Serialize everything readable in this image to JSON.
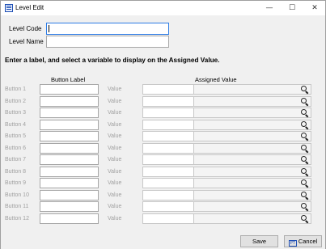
{
  "window": {
    "title": "Level Edit",
    "minimize_glyph": "—",
    "maximize_glyph": "☐",
    "close_glyph": "✕"
  },
  "form": {
    "level_code_label": "Level Code",
    "level_code_value": "",
    "level_name_label": "Level Name",
    "level_name_value": ""
  },
  "instruction": "Enter a label, and select a variable to display on the Assigned Value.",
  "columns": {
    "button_label": "Button Label",
    "assigned_value": "Assigned Value"
  },
  "rows": [
    {
      "label": "Button 1",
      "value_label": "Value"
    },
    {
      "label": "Button 2",
      "value_label": "Value"
    },
    {
      "label": "Button 3",
      "value_label": "Value"
    },
    {
      "label": "Button 4",
      "value_label": "Value"
    },
    {
      "label": "Button 5",
      "value_label": "Value"
    },
    {
      "label": "Button 6",
      "value_label": "Value"
    },
    {
      "label": "Button 7",
      "value_label": "Value"
    },
    {
      "label": "Button 8",
      "value_label": "Value"
    },
    {
      "label": "Button 9",
      "value_label": "Value"
    },
    {
      "label": "Button 10",
      "value_label": "Value"
    },
    {
      "label": "Button 11",
      "value_label": "Value"
    },
    {
      "label": "Button 12",
      "value_label": "Value"
    }
  ],
  "buttons": {
    "save": "Save",
    "cancel": "Cancel"
  },
  "icons": {
    "app": "level-edit-app-icon",
    "search": "magnifier-icon",
    "cancel": "cancel-icon"
  },
  "colors": {
    "focus_border": "#2c7be5",
    "disabled_text": "#a0a0a0",
    "window_bg": "#f0f0f0"
  }
}
